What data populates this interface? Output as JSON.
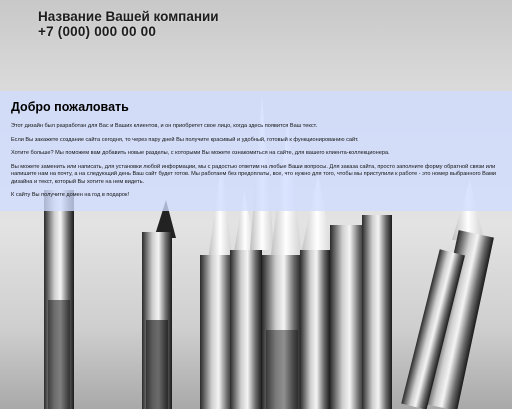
{
  "header": {
    "company_name": "Название Вашей компании",
    "phone": "+7 (000) 000 00 00"
  },
  "main": {
    "title": "Добро пожаловать",
    "paragraphs": [
      "Этот дизайн был разработан для Вас и Ваших клиентов, и он приобретет свое лицо, когда здесь появится Ваш текст.",
      "Если Вы закажете создание сайта сегодня, то через пару дней Вы получите красивый и удобный, готовый к функционированию сайт.",
      "Хотите больше? Мы поможем вам добавить новые разделы, с которыми Вы можете ознакомиться на сайте, для вашего клиента-коллекционера.",
      "Вы можете заменить или написать, для установки любой информации, мы с радостью ответим на любые Ваши вопросы. Для заказа сайта, просто заполните форму обратной связи или напишите нам на почту, а на следующий день Ваш сайт будет готов. Мы работаем без предоплаты, все, что нужно для того, чтобы мы приступили к работе - это номер выбранного Вами дизайна и текст, который Вы хотите на нем видеть.",
      "К сайту Вы получите домен на год в подарок!"
    ]
  },
  "colors": {
    "panel": "#d0dcff",
    "background": "#d9d9d9"
  }
}
